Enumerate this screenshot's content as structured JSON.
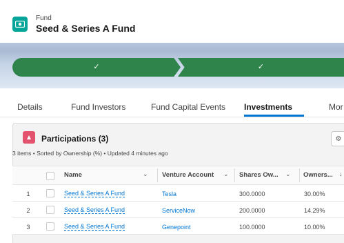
{
  "header": {
    "object_type": "Fund",
    "record_name": "Seed & Series A Fund",
    "icon": "fund-record-icon"
  },
  "path": {
    "stages": [
      {
        "status": "complete",
        "icon": "check-icon"
      },
      {
        "status": "complete",
        "icon": "check-icon"
      }
    ],
    "colors": {
      "complete": "#2e844a"
    }
  },
  "tabs": [
    {
      "label": "Details"
    },
    {
      "label": "Fund Investors"
    },
    {
      "label": "Fund Capital Events"
    },
    {
      "label": "Investments",
      "active": true
    },
    {
      "label": "Mor"
    }
  ],
  "related_list": {
    "title": "Participations (3)",
    "meta": "3 items • Sorted by Ownership (%) • Updated 4 minutes ago",
    "icon": "participations-icon",
    "action_icon": "gear-icon",
    "columns": [
      {
        "label": "Name"
      },
      {
        "label": "Venture Account"
      },
      {
        "label": "Shares Ow..."
      },
      {
        "label": "Owners..."
      }
    ],
    "rows": [
      {
        "num": "1",
        "name": "Seed & Series A Fund",
        "account": "Tesla",
        "shares": "300.0000",
        "ownership": "30.00%"
      },
      {
        "num": "2",
        "name": "Seed & Series A Fund",
        "account": "ServiceNow",
        "shares": "200.0000",
        "ownership": "14.29%"
      },
      {
        "num": "3",
        "name": "Seed & Series A Fund",
        "account": "Genepoint",
        "shares": "100.0000",
        "ownership": "10.00%"
      }
    ]
  },
  "colors": {
    "brand": "#0176d3",
    "record_icon": "#06a59a",
    "list_icon": "#e3536e"
  }
}
